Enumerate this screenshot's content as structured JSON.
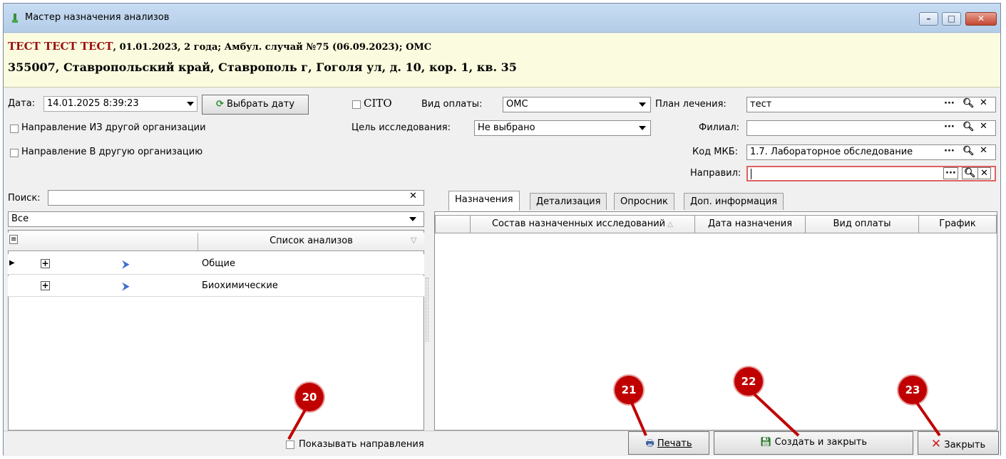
{
  "window": {
    "title": "Мастер назначения анализов",
    "minimize_icon": "minimize-icon",
    "maximize_icon": "maximize-icon",
    "close_icon": "close-icon"
  },
  "patient": {
    "name": "ТЕСТ ТЕСТ ТЕСТ",
    "info": ", 01.01.2023, 2 года; Амбул. случай №75 (06.09.2023); ОМС",
    "address": "355007, Ставропольский край, Ставрополь г, Гоголя ул, д. 10, кор. 1, кв. 35"
  },
  "form": {
    "date_label": "Дата:",
    "date_value": "14.01.2025 8:39:23",
    "pick_date_button": "Выбрать дату",
    "cito_label": "CITO",
    "payment_label": "Вид оплаты:",
    "payment_value": "ОМС",
    "purpose_label": "Цель исследования:",
    "purpose_value": "Не выбрано",
    "from_org_label": "Направление ИЗ другой организации",
    "to_org_label": "Направление В другую организацию",
    "plan_label": "План лечения:",
    "plan_value": "тест",
    "branch_label": "Филиал:",
    "branch_value": "",
    "mkb_label": "Код МКБ:",
    "mkb_value": "1.7. Лабораторное обследование",
    "referrer_label": "Направил:",
    "referrer_value": ""
  },
  "left": {
    "search_label": "Поиск:",
    "search_value": "",
    "filter_value": "Все",
    "list_header": "Список анализов",
    "items": [
      {
        "name": "Общие"
      },
      {
        "name": "Биохимические"
      }
    ]
  },
  "right": {
    "tabs": [
      "Назначения",
      "Детализация",
      "Опросник",
      "Доп. информация"
    ],
    "columns": [
      "Состав назначенных исследований",
      "Дата назначения",
      "Вид оплаты",
      "График"
    ]
  },
  "footer": {
    "show_referrals_label": "Показывать направления",
    "print_button": "Печать",
    "create_close_button": "Создать и закрыть",
    "close_button": "Закрыть"
  },
  "badges": [
    "20",
    "21",
    "22",
    "23"
  ],
  "colors": {
    "patient_bg": "#fbfbdf",
    "patient_name": "#9a1010",
    "badge": "#c00000",
    "titlebar": "#c7dcf2"
  }
}
